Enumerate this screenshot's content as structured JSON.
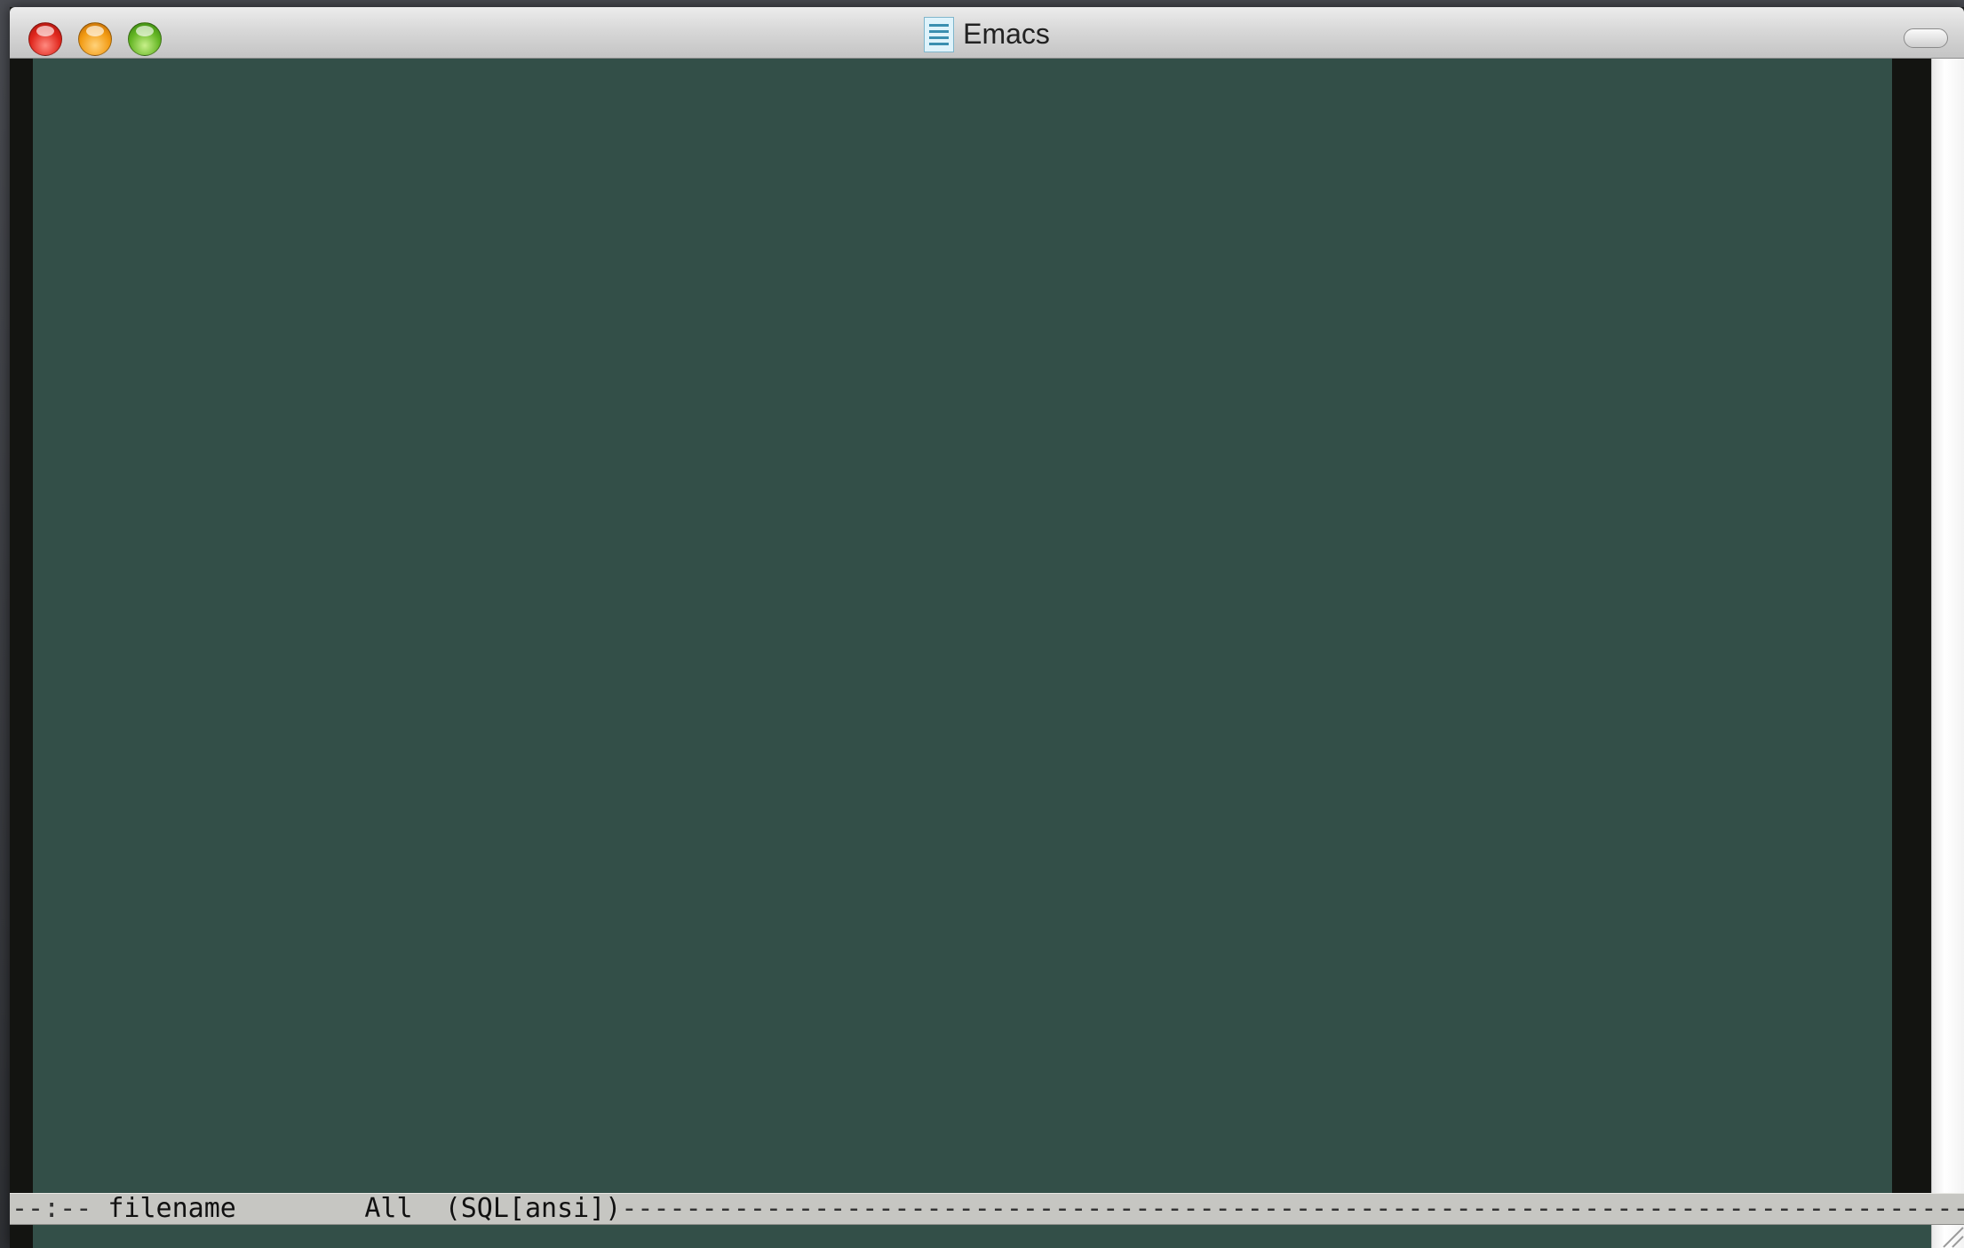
{
  "window": {
    "title": "Emacs",
    "icon": "document-icon"
  },
  "modeline": {
    "status": "--:--",
    "buffer_name": "filename",
    "position": "All",
    "mode": "(SQL[ansi])",
    "fill": "-----------------------------------------------------------------------------------------------"
  },
  "colors": {
    "editor_background": "#334f48",
    "fringe": "#131411",
    "modeline_background": "#c6c6c2"
  }
}
